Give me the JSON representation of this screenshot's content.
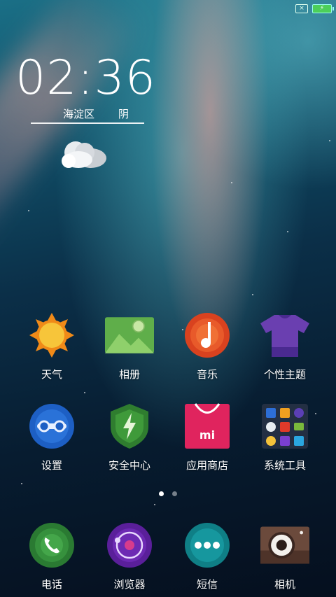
{
  "status": {
    "sim_text": "×",
    "battery_text": "⚡"
  },
  "clock": {
    "time": "02:36",
    "district": "海淀区",
    "condition": "阴"
  },
  "apps_row1": [
    {
      "label": "天气"
    },
    {
      "label": "相册"
    },
    {
      "label": "音乐"
    },
    {
      "label": "个性主题"
    }
  ],
  "apps_row2": [
    {
      "label": "设置"
    },
    {
      "label": "安全中心"
    },
    {
      "label": "应用商店"
    },
    {
      "label": "系统工具"
    }
  ],
  "dock": [
    {
      "label": "电话"
    },
    {
      "label": "浏览器"
    },
    {
      "label": "短信"
    },
    {
      "label": "相机"
    }
  ],
  "store_logo_text": "mi",
  "pager": {
    "pages": 2,
    "active": 1
  }
}
